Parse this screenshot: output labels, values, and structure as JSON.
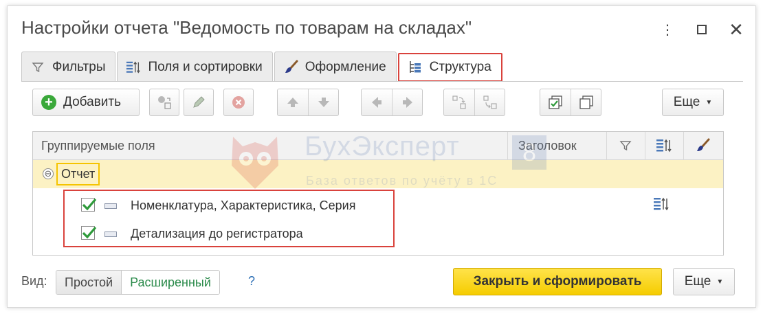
{
  "window": {
    "title": "Настройки отчета \"Ведомость по товарам на складах\"",
    "more_glyph": "⋮",
    "close_glyph": "✕"
  },
  "tabs": [
    {
      "label": "Фильтры",
      "icon": "filter-icon"
    },
    {
      "label": "Поля и сортировки",
      "icon": "sort-icon"
    },
    {
      "label": "Оформление",
      "icon": "brush-icon"
    },
    {
      "label": "Структура",
      "icon": "structure-icon",
      "active": true
    }
  ],
  "toolbar": {
    "add_label": "Добавить",
    "more_label": "Еще",
    "icons": [
      "add-circle-icon",
      "add-group-icon",
      "pencil-icon",
      "delete-icon",
      "arrow-up-icon",
      "arrow-down-icon",
      "arrow-left-icon",
      "arrow-right-icon",
      "move-into-icon",
      "move-out-icon",
      "check-all-icon",
      "copy-icon"
    ]
  },
  "grid": {
    "columns": {
      "fields": "Группируемые поля",
      "title": "Заголовок"
    },
    "root": {
      "label": "Отчет",
      "collapse_glyph": "⊖"
    },
    "rows": [
      {
        "label": "Номенклатура, Характеристика, Серия",
        "checked": true,
        "has_sort": true
      },
      {
        "label": "Детализация до регистратора",
        "checked": true,
        "has_sort": false
      }
    ]
  },
  "watermark": {
    "name": "БухЭксперт",
    "badge": "8",
    "tagline": "База ответов по учёту в 1С"
  },
  "footer": {
    "view_label": "Вид:",
    "view_options": [
      "Простой",
      "Расширенный"
    ],
    "help": "?",
    "primary_label": "Закрыть и сформировать",
    "more_label": "Еще"
  },
  "colors": {
    "highlight_red": "#d9423c",
    "yellow_outline": "#f5c400",
    "row_highlight": "#fcf2c4",
    "check_green": "#2e9a3a",
    "primary_yellow": "#f5cc00"
  }
}
